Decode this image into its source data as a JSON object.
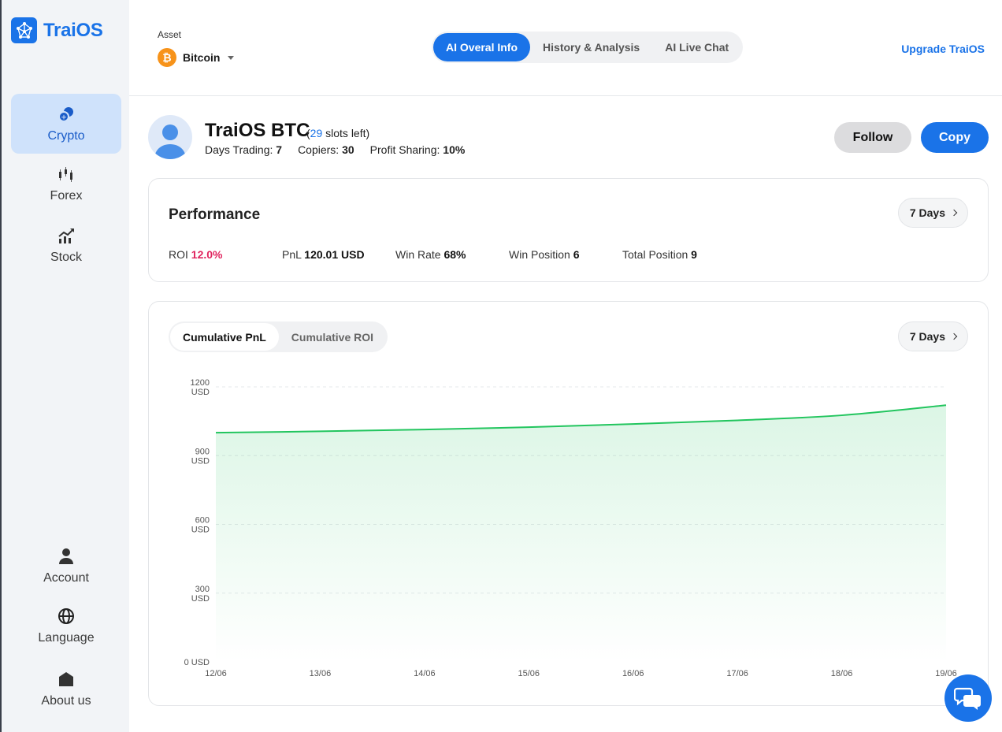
{
  "brand": {
    "name": "TraiOS",
    "color": "#1a73e8"
  },
  "sidebar": {
    "top_items": [
      {
        "label": "Crypto",
        "icon": "crypto-coins-icon",
        "active": true
      },
      {
        "label": "Forex",
        "icon": "candlestick-icon",
        "active": false
      },
      {
        "label": "Stock",
        "icon": "stock-chart-icon",
        "active": false
      }
    ],
    "bottom_items": [
      {
        "label": "Account",
        "icon": "user-icon"
      },
      {
        "label": "Language",
        "icon": "globe-icon"
      },
      {
        "label": "About us",
        "icon": "home-icon"
      }
    ]
  },
  "header": {
    "asset_label": "Asset",
    "asset_value": "Bitcoin",
    "asset_icon": "bitcoin-icon",
    "tabs": [
      {
        "label": "AI Overal Info",
        "active": true
      },
      {
        "label": "History & Analysis",
        "active": false
      },
      {
        "label": "AI Live Chat",
        "active": false
      }
    ],
    "upgrade_label": "Upgrade TraiOS"
  },
  "trader": {
    "name": "TraiOS BTC",
    "slots_open": "(",
    "slots_num": "29",
    "slots_close": " slots left)",
    "days_label": "Days Trading:",
    "days_value": "7",
    "copiers_label": "Copiers:",
    "copiers_value": "30",
    "profit_label": "Profit Sharing:",
    "profit_value": "10%",
    "follow_label": "Follow",
    "copy_label": "Copy"
  },
  "performance": {
    "title": "Performance",
    "period": "7 Days",
    "roi_label": "ROI",
    "roi_value": "12.0%",
    "pnl_label": "PnL",
    "pnl_value": "120.01 USD",
    "winrate_label": "Win Rate",
    "winrate_value": "68%",
    "winpos_label": "Win Position",
    "winpos_value": "6",
    "totalpos_label": "Total Position",
    "totalpos_value": "9"
  },
  "chart_panel": {
    "toggles": [
      {
        "label": "Cumulative PnL",
        "active": true
      },
      {
        "label": "Cumulative ROI",
        "active": false
      }
    ],
    "period": "7 Days"
  },
  "chart_data": {
    "type": "area",
    "x": [
      "12/06",
      "13/06",
      "14/06",
      "15/06",
      "16/06",
      "17/06",
      "18/06",
      "19/06"
    ],
    "values": [
      1000,
      1006,
      1014,
      1024,
      1038,
      1054,
      1076,
      1120
    ],
    "ylim": [
      0,
      1200
    ],
    "yticks": [
      {
        "value": 0,
        "label": [
          "0 USD"
        ]
      },
      {
        "value": 300,
        "label": [
          "300",
          "USD"
        ]
      },
      {
        "value": 600,
        "label": [
          "600",
          "USD"
        ]
      },
      {
        "value": 900,
        "label": [
          "900",
          "USD"
        ]
      },
      {
        "value": 1200,
        "label": [
          "1200",
          "USD"
        ]
      }
    ],
    "grid": true,
    "line_color": "#22c55e",
    "fill_color": "#22c55e"
  },
  "chat_icon": "chat-bubbles-icon"
}
